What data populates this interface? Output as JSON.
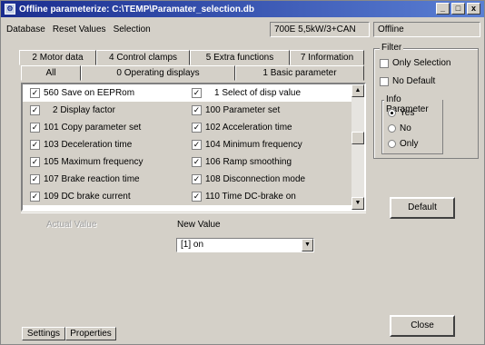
{
  "window": {
    "title": "Offline parameterize: C:\\TEMP\\Paramater_selection.db",
    "minimize": "_",
    "maximize": "□",
    "close": "x"
  },
  "menu": [
    "Database",
    "Reset Values",
    "Selection"
  ],
  "status": {
    "device": "700E 5,5kW/3+CAN",
    "mode": "Offline"
  },
  "tabs": {
    "row1": [
      "2 Motor data",
      "4 Control clamps",
      "5 Extra functions",
      "7 Information"
    ],
    "row2": [
      "All",
      "0 Operating displays",
      "1 Basic parameter"
    ]
  },
  "params": [
    {
      "label": "560 Save on EEPRom",
      "checked": true
    },
    {
      "label": "1 Select of disp value",
      "checked": true
    },
    {
      "label": "2 Display factor",
      "checked": true
    },
    {
      "label": "100 Parameter set",
      "checked": true
    },
    {
      "label": "101 Copy parameter set",
      "checked": true
    },
    {
      "label": "102 Acceleration time",
      "checked": true
    },
    {
      "label": "103 Deceleration time",
      "checked": true
    },
    {
      "label": "104 Minimum frequency",
      "checked": true
    },
    {
      "label": "105 Maximum frequency",
      "checked": true
    },
    {
      "label": "106 Ramp smoothing",
      "checked": true
    },
    {
      "label": "107 Brake reaction time",
      "checked": true
    },
    {
      "label": "108 Disconnection mode",
      "checked": true
    },
    {
      "label": "109 DC brake current",
      "checked": true
    },
    {
      "label": "110 Time DC-brake on",
      "checked": true
    }
  ],
  "check_glyph": "✓",
  "lower": {
    "actual_value_label": "Actual Value",
    "new_value_label": "New Value",
    "new_value": "[1] on"
  },
  "bottom_tabs": [
    "Settings",
    "Properties"
  ],
  "filter": {
    "title": "Filter",
    "only_selection": "Only Selection",
    "no_default": "No Default",
    "info_title": "Info Parameter",
    "yes": "Yes",
    "no": "No",
    "only": "Only",
    "selected": "Yes"
  },
  "buttons": {
    "default": "Default",
    "close": "Close"
  }
}
